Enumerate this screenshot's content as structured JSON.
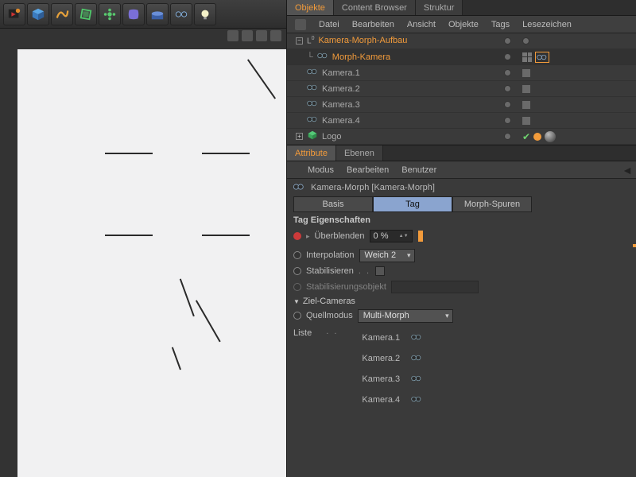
{
  "top_tabs": {
    "objects": "Objekte",
    "content_browser": "Content Browser",
    "structure": "Struktur"
  },
  "obj_menu": {
    "file": "Datei",
    "edit": "Bearbeiten",
    "view": "Ansicht",
    "objects": "Objekte",
    "tags": "Tags",
    "bookmarks": "Lesezeichen"
  },
  "tree": {
    "root": "Kamera-Morph-Aufbau",
    "morph_cam": "Morph-Kamera",
    "cam1": "Kamera.1",
    "cam2": "Kamera.2",
    "cam3": "Kamera.3",
    "cam4": "Kamera.4",
    "logo": "Logo"
  },
  "attr_tabs": {
    "attribute": "Attribute",
    "layers": "Ebenen"
  },
  "attr_menu": {
    "mode": "Modus",
    "edit": "Bearbeiten",
    "user": "Benutzer"
  },
  "attr_header": "Kamera-Morph [Kamera-Morph]",
  "attr_type_tabs": {
    "basis": "Basis",
    "tag": "Tag",
    "morph_tracks": "Morph-Spuren"
  },
  "section_tag_props": "Tag Eigenschaften",
  "props": {
    "blend_label": "Überblenden",
    "blend_value": "0 %",
    "interp_label": "Interpolation",
    "interp_value": "Weich 2",
    "stabilize_label": "Stabilisieren",
    "stabilize_dots": ". .",
    "stabobj_label": "Stabilisierungsobjekt"
  },
  "section_target_cams": "Ziel-Cameras",
  "source_mode_label": "Quellmodus",
  "source_mode_value": "Multi-Morph",
  "list_label": "Liste",
  "list_items": {
    "0": "Kamera.1",
    "1": "Kamera.2",
    "2": "Kamera.3",
    "3": "Kamera.4"
  }
}
